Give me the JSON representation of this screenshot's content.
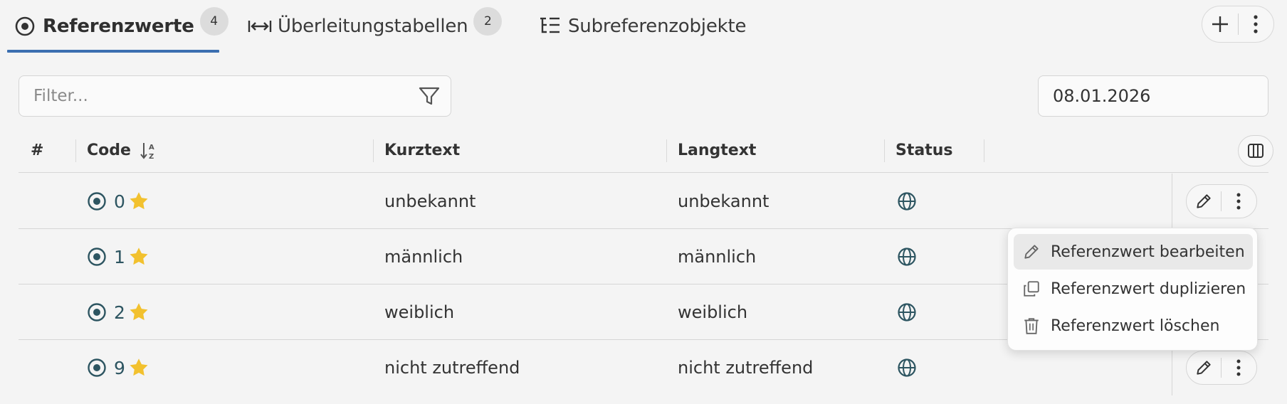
{
  "tabs": [
    {
      "label": "Referenzwerte",
      "count": "4",
      "icon": "radio-target-icon",
      "active": true
    },
    {
      "label": "Überleitungstabellen",
      "count": "2",
      "icon": "arrows-horizontal-icon",
      "active": false
    },
    {
      "label": "Subreferenzobjekte",
      "icon": "tree-list-icon",
      "active": false
    }
  ],
  "header_actions": {
    "add_icon": "plus-icon",
    "more_icon": "vertical-dots-icon"
  },
  "filter": {
    "placeholder": "Filter...",
    "value": "",
    "icon": "filter-funnel-icon"
  },
  "date": {
    "value": "08.01.2026"
  },
  "table": {
    "columns": {
      "index": "#",
      "code": "Code",
      "kurztext": "Kurztext",
      "langtext": "Langtext",
      "status": "Status"
    },
    "sort": {
      "column": "code",
      "direction": "ascending",
      "icon": "sort-az-icon"
    },
    "rows": [
      {
        "code": "0",
        "kurztext": "unbekannt",
        "langtext": "unbekannt",
        "status_icon": "globe-icon",
        "favorite": true
      },
      {
        "code": "1",
        "kurztext": "männlich",
        "langtext": "männlich",
        "status_icon": "globe-icon",
        "favorite": true
      },
      {
        "code": "2",
        "kurztext": "weiblich",
        "langtext": "weiblich",
        "status_icon": "globe-icon",
        "favorite": true
      },
      {
        "code": "9",
        "kurztext": "nicht zutreffend",
        "langtext": "nicht zutreffend",
        "status_icon": "globe-icon",
        "favorite": true
      }
    ]
  },
  "context_menu": {
    "items": [
      {
        "label": "Referenzwert bearbeiten",
        "icon": "pencil-icon"
      },
      {
        "label": "Referenzwert duplizieren",
        "icon": "copy-icon"
      },
      {
        "label": "Referenzwert löschen",
        "icon": "trash-icon"
      }
    ]
  },
  "colors": {
    "accent": "#3b6fb0",
    "star": "#f2c12e",
    "code": "#2d5561",
    "background": "#f4f4f4"
  }
}
